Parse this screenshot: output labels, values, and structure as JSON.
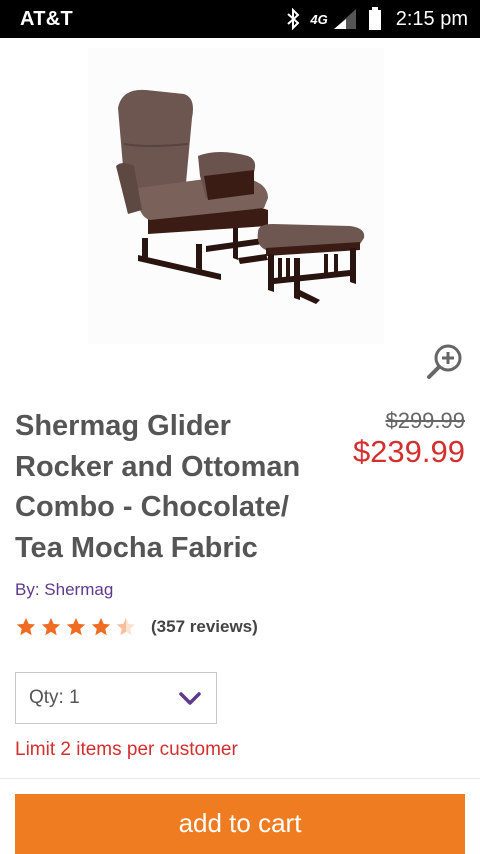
{
  "status_bar": {
    "carrier": "AT&T",
    "network": "4G",
    "time": "2:15 pm",
    "icons": [
      "bluetooth-icon",
      "signal-icon",
      "battery-icon"
    ]
  },
  "product": {
    "image_alt": "glider-rocker-and-ottoman",
    "title": "Shermag Glider Rocker and Ottoman Combo - Chocolate/ Tea Mocha Fabric",
    "original_price": "$299.99",
    "sale_price": "$239.99",
    "brand_prefix": "By:",
    "brand": "Shermag",
    "rating": 4.5,
    "rating_max": 5,
    "review_count": "(357 reviews)"
  },
  "quantity": {
    "label": "Qty: 1"
  },
  "limit_note": "Limit 2 items per customer",
  "cart_button": "add to cart",
  "colors": {
    "accent_orange": "#f07c22",
    "price_red": "#d32f2f",
    "brand_purple": "#5e3a8c",
    "star_orange": "#ef6c22"
  }
}
